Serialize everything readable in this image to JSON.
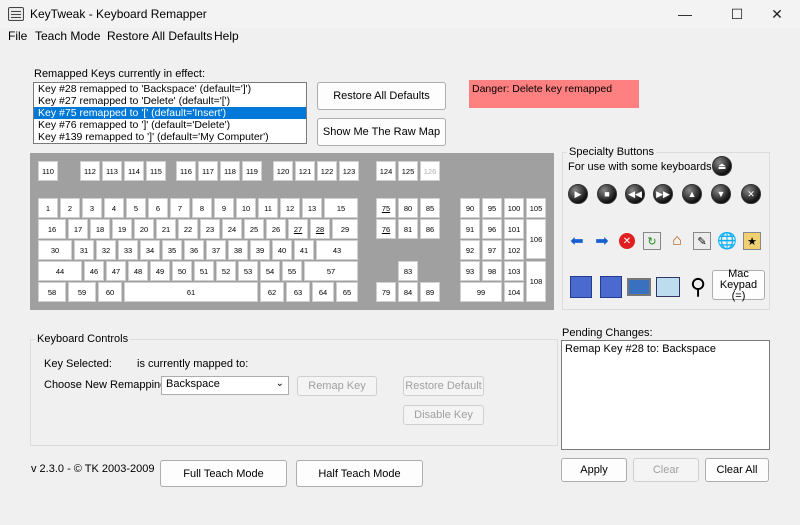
{
  "window": {
    "title": "KeyTweak -  Keyboard Remapper",
    "minimize": "—",
    "maximize": "☐",
    "close": "✕"
  },
  "menu": [
    "File",
    "Teach Mode",
    "Restore All Defaults",
    "Help"
  ],
  "remapped": {
    "label": "Remapped Keys currently in effect:",
    "items": [
      "Key #28 remapped to 'Backspace' (default=']')",
      "Key #27 remapped to 'Delete' (default='[')",
      "Key #75 remapped to '[' (default='Insert')",
      "Key #76 remapped to ']' (default='Delete')",
      "Key #139 remapped to ']' (default='My Computer')"
    ],
    "selected_index": 2
  },
  "buttons": {
    "restore_all": "Restore All Defaults",
    "raw_map": "Show Me The Raw Map",
    "remap_key": "Remap Key",
    "restore_default": "Restore Default",
    "disable_key": "Disable Key",
    "full_teach": "Full Teach Mode",
    "half_teach": "Half Teach Mode",
    "apply": "Apply",
    "clear": "Clear",
    "clear_all": "Clear All"
  },
  "danger": "Danger: Delete key remapped",
  "specialty": {
    "legend": "Specialty Buttons",
    "note": "For use with some keyboards",
    "mac_keypad": "Mac Keypad (=)",
    "icons": [
      "eject-icon",
      "play-icon",
      "stop-icon",
      "rewind-icon",
      "fast-forward-icon",
      "volume-up-icon",
      "volume-down-icon",
      "mute-icon",
      "back-arrow-icon",
      "forward-arrow-icon",
      "stop-web-icon",
      "refresh-icon",
      "home-icon",
      "search-web-icon",
      "favorites-icon",
      "folder-icon",
      "my-computer-icon",
      "calculator-icon",
      "mail-icon",
      "media-icon",
      "magnifier-icon"
    ]
  },
  "keys_row0": [
    "110",
    "112",
    "113",
    "114",
    "115",
    "116",
    "117",
    "118",
    "119",
    "120",
    "121",
    "122",
    "123",
    "124",
    "125",
    "126"
  ],
  "keys_row1": [
    "1",
    "2",
    "3",
    "4",
    "5",
    "6",
    "7",
    "8",
    "9",
    "10",
    "11",
    "12",
    "13",
    "15",
    "75",
    "80",
    "85",
    "90",
    "95",
    "100",
    "105"
  ],
  "keys_row2": [
    "16",
    "17",
    "18",
    "19",
    "20",
    "21",
    "22",
    "23",
    "24",
    "25",
    "26",
    "27",
    "28",
    "29",
    "76",
    "81",
    "86",
    "91",
    "96",
    "101",
    "106"
  ],
  "keys_row3": [
    "30",
    "31",
    "32",
    "33",
    "34",
    "35",
    "36",
    "37",
    "38",
    "39",
    "40",
    "41",
    "43",
    "92",
    "97",
    "102"
  ],
  "keys_row4": [
    "44",
    "46",
    "47",
    "48",
    "49",
    "50",
    "51",
    "52",
    "53",
    "54",
    "55",
    "57",
    "83",
    "93",
    "98",
    "103",
    "108"
  ],
  "keys_row5": [
    "58",
    "59",
    "60",
    "61",
    "62",
    "63",
    "64",
    "65",
    "79",
    "84",
    "89",
    "99",
    "104"
  ],
  "controls": {
    "legend": "Keyboard Controls",
    "key_selected": "Key Selected:",
    "mapped_to": "is currently mapped to:",
    "choose": "Choose New Remapping",
    "selection": "Backspace"
  },
  "pending": {
    "label": "Pending Changes:",
    "items": [
      "Remap Key #28 to: Backspace"
    ]
  },
  "version": "v 2.3.0 - © TK 2003-2009"
}
